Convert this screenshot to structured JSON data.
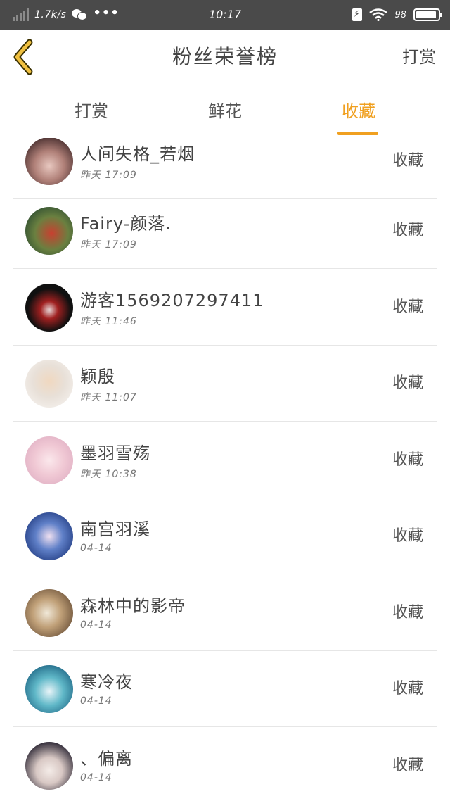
{
  "status_bar": {
    "network_speed": "1.7k/s",
    "time": "10:17",
    "battery_percent": "98",
    "icons": [
      "signal-icon",
      "wechat-icon",
      "more-dots-icon",
      "charging-icon",
      "wifi-icon",
      "battery-icon"
    ]
  },
  "header": {
    "title": "粉丝荣誉榜",
    "action_label": "打赏",
    "back_icon": "chevron-left-icon",
    "accent_color": "#f0a020"
  },
  "tabs": [
    {
      "label": "打赏",
      "active": false
    },
    {
      "label": "鲜花",
      "active": false
    },
    {
      "label": "收藏",
      "active": true
    }
  ],
  "list": {
    "action_label": "收藏",
    "items": [
      {
        "name": "人间失格_若烟",
        "time": "昨天 17:09"
      },
      {
        "name": "Fairy-颜落.",
        "time": "昨天 17:09"
      },
      {
        "name": "游客1569207297411",
        "time": "昨天 11:46"
      },
      {
        "name": "颖殷",
        "time": "昨天 11:07"
      },
      {
        "name": "墨羽雪殇",
        "time": "昨天 10:38"
      },
      {
        "name": "南宫羽溪",
        "time": "04-14"
      },
      {
        "name": "森林中的影帝",
        "time": "04-14"
      },
      {
        "name": "寒冷夜",
        "time": "04-14"
      },
      {
        "name": "、偏离",
        "time": "04-14"
      }
    ]
  }
}
